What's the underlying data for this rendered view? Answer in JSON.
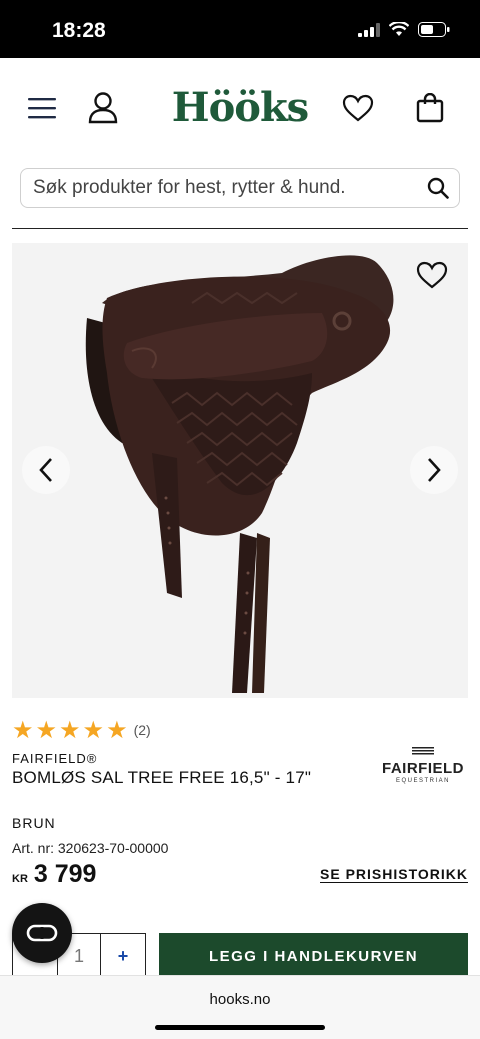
{
  "status_bar": {
    "time": "18:28"
  },
  "header": {
    "logo": "Hööks",
    "icons": [
      "menu-icon",
      "user-icon",
      "heart-icon",
      "bag-icon"
    ]
  },
  "search": {
    "placeholder": "Søk produkter for hest, rytter & hund."
  },
  "product": {
    "rating": 5,
    "review_count": "(2)",
    "brand": "FAIRFIELD®",
    "title": "BOMLØS SAL TREE FREE 16,5\" - 17\"",
    "brand_logo": {
      "name": "FAIRFIELD",
      "subtitle": "EQUESTRIAN"
    },
    "color": "BRUN",
    "art_nr": "Art. nr: 320623-70-00000",
    "currency": "KR",
    "price": "3 799",
    "price_history_link": "SE PRISHISTORIKK",
    "quantity": "1",
    "qty_plus": "+",
    "qty_minus": "-",
    "add_to_cart": "LEGG I HANDLEKURVEN"
  },
  "colors": {
    "brand_green": "#1f5a3a",
    "cart_button": "#1c4a2c",
    "star": "#f5a623"
  },
  "browser": {
    "url": "hooks.no"
  }
}
